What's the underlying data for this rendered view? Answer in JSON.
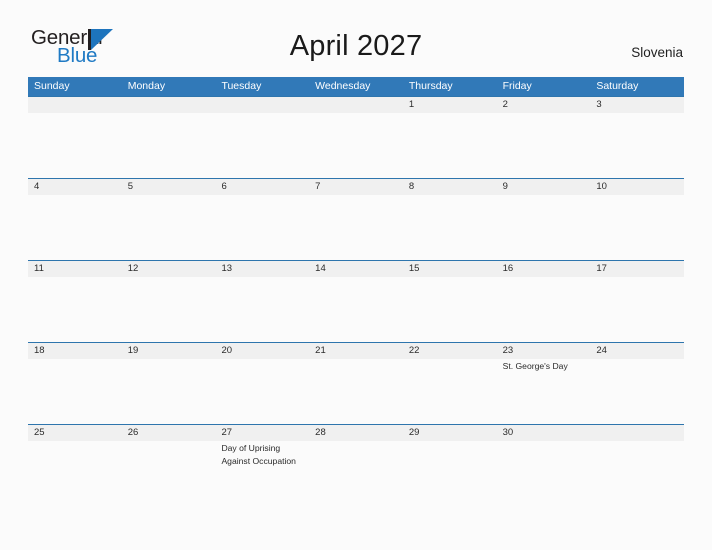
{
  "brand": {
    "word_one": "General",
    "word_two": "Blue",
    "mark_icon": "flag-triangle-icon",
    "accent_color": "#1d74bd"
  },
  "header": {
    "title": "April 2027",
    "region": "Slovenia"
  },
  "theme": {
    "header_blue": "#3179b8",
    "rule_blue": "#2e75ad",
    "date_band_gray": "#f0f0f0",
    "page_background": "#fbfbfb",
    "text_color": "#2b2b2b"
  },
  "calendar": {
    "weekdays": [
      "Sunday",
      "Monday",
      "Tuesday",
      "Wednesday",
      "Thursday",
      "Friday",
      "Saturday"
    ],
    "weeks": [
      {
        "days": [
          {
            "number": "",
            "events": []
          },
          {
            "number": "",
            "events": []
          },
          {
            "number": "",
            "events": []
          },
          {
            "number": "",
            "events": []
          },
          {
            "number": "1",
            "events": []
          },
          {
            "number": "2",
            "events": []
          },
          {
            "number": "3",
            "events": []
          }
        ]
      },
      {
        "days": [
          {
            "number": "4",
            "events": []
          },
          {
            "number": "5",
            "events": []
          },
          {
            "number": "6",
            "events": []
          },
          {
            "number": "7",
            "events": []
          },
          {
            "number": "8",
            "events": []
          },
          {
            "number": "9",
            "events": []
          },
          {
            "number": "10",
            "events": []
          }
        ]
      },
      {
        "days": [
          {
            "number": "11",
            "events": []
          },
          {
            "number": "12",
            "events": []
          },
          {
            "number": "13",
            "events": []
          },
          {
            "number": "14",
            "events": []
          },
          {
            "number": "15",
            "events": []
          },
          {
            "number": "16",
            "events": []
          },
          {
            "number": "17",
            "events": []
          }
        ]
      },
      {
        "days": [
          {
            "number": "18",
            "events": []
          },
          {
            "number": "19",
            "events": []
          },
          {
            "number": "20",
            "events": []
          },
          {
            "number": "21",
            "events": []
          },
          {
            "number": "22",
            "events": []
          },
          {
            "number": "23",
            "events": [
              "St. George's Day"
            ]
          },
          {
            "number": "24",
            "events": []
          }
        ]
      },
      {
        "days": [
          {
            "number": "25",
            "events": []
          },
          {
            "number": "26",
            "events": []
          },
          {
            "number": "27",
            "events": [
              "Day of Uprising",
              "Against Occupation"
            ]
          },
          {
            "number": "28",
            "events": []
          },
          {
            "number": "29",
            "events": []
          },
          {
            "number": "30",
            "events": []
          },
          {
            "number": "",
            "events": []
          }
        ]
      }
    ]
  }
}
